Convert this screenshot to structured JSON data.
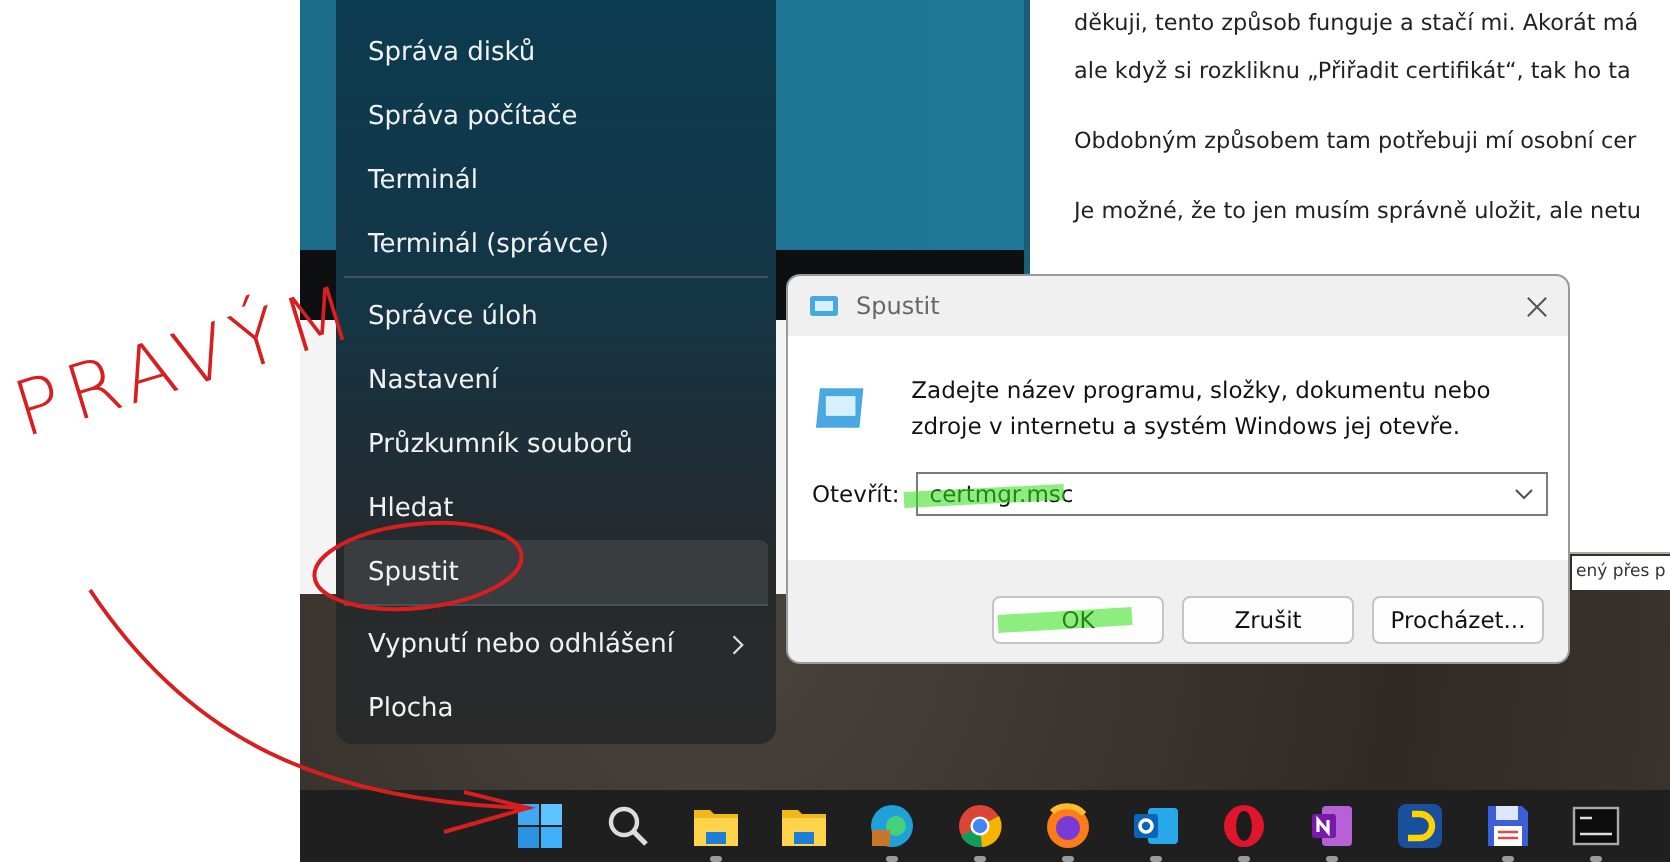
{
  "annotation": {
    "text": "PRAVÝM"
  },
  "document": {
    "paragraphs": [
      [
        "děkuji, tento způsob funguje a stačí mi. Akorát má",
        "ale když si rozkliknu „Přiřadit certifikát“, tak ho ta"
      ],
      [
        "Obdobným způsobem tam potřebuji mí osobní cer"
      ],
      [
        "Je možné, že to jen musím správně uložit, ale netu"
      ]
    ],
    "fragment": "ený přes p"
  },
  "menu": {
    "items": [
      {
        "label": "Správa disků",
        "selected": false,
        "submenu": false,
        "divider_after": false
      },
      {
        "label": "Správa počítače",
        "selected": false,
        "submenu": false,
        "divider_after": false
      },
      {
        "label": "Terminál",
        "selected": false,
        "submenu": false,
        "divider_after": false
      },
      {
        "label": "Terminál (správce)",
        "selected": false,
        "submenu": false,
        "divider_after": true
      },
      {
        "label": "Správce úloh",
        "selected": false,
        "submenu": false,
        "divider_after": false
      },
      {
        "label": "Nastavení",
        "selected": false,
        "submenu": false,
        "divider_after": false
      },
      {
        "label": "Průzkumník souborů",
        "selected": false,
        "submenu": false,
        "divider_after": false
      },
      {
        "label": "Hledat",
        "selected": false,
        "submenu": false,
        "divider_after": false
      },
      {
        "label": "Spustit",
        "selected": true,
        "submenu": false,
        "divider_after": true
      },
      {
        "label": "Vypnutí nebo odhlášení",
        "selected": false,
        "submenu": true,
        "divider_after": false
      },
      {
        "label": "Plocha",
        "selected": false,
        "submenu": false,
        "divider_after": false
      }
    ]
  },
  "dialog": {
    "title": "Spustit",
    "message": "Zadejte název programu, složky, dokumentu nebo zdroje v internetu a systém Windows jej otevře.",
    "open_label": "Otevřít:",
    "command": "certmgr.msc",
    "buttons": [
      "OK",
      "Zrušit",
      "Procházet..."
    ]
  },
  "taskbar": {
    "icons": [
      {
        "kind": "start",
        "running": false
      },
      {
        "kind": "search",
        "running": false
      },
      {
        "kind": "folder",
        "running": true
      },
      {
        "kind": "folder",
        "running": false
      },
      {
        "kind": "edge",
        "running": true
      },
      {
        "kind": "chrome",
        "running": true
      },
      {
        "kind": "firefox",
        "running": true
      },
      {
        "kind": "mail",
        "running": true
      },
      {
        "kind": "opera",
        "running": true
      },
      {
        "kind": "note",
        "running": true
      },
      {
        "kind": "d",
        "running": false
      },
      {
        "kind": "floppy",
        "running": true
      },
      {
        "kind": "terminal",
        "running": true
      }
    ]
  }
}
